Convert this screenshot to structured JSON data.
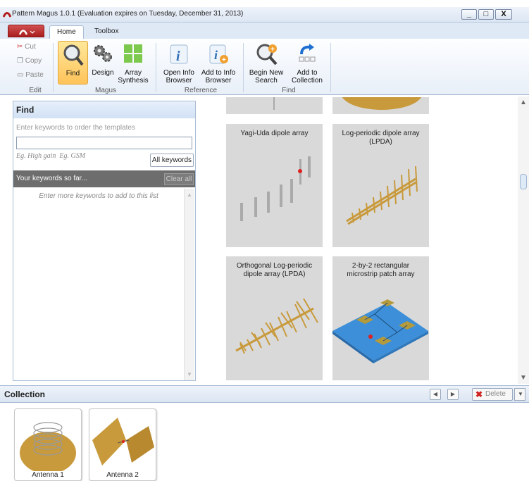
{
  "window": {
    "title": "Pattern Magus 1.0.1 (Evaluation expires on Tuesday, December 31, 2013)",
    "minimize_label": "_",
    "maximize_label": "□",
    "close_label": "X"
  },
  "tabs": {
    "home": "Home",
    "toolbox": "Toolbox"
  },
  "ribbon": {
    "edit": {
      "cut": "Cut",
      "copy": "Copy",
      "paste": "Paste",
      "group": "Edit"
    },
    "magus": {
      "find": "Find",
      "design": "Design",
      "array_synthesis": "Array\nSynthesis",
      "group": "Magus"
    },
    "reference": {
      "open_info": "Open Info\nBrowser",
      "add_info": "Add to Info\nBrowser",
      "group": "Reference"
    },
    "find": {
      "begin_search": "Begin New\nSearch",
      "add_collection": "Add to\nCollection",
      "group": "Find"
    }
  },
  "find_panel": {
    "title": "Find",
    "hint": "Enter keywords to order the templates",
    "examples": "Eg. High gain  Eg. GSM",
    "all_keywords": "All keywords",
    "your_keywords": "Your keywords so far...",
    "clear_all": "Clear all",
    "empty_hint": "Enter more keywords to add to this list",
    "input_value": ""
  },
  "gallery": [
    {
      "title": "Yagi-Uda dipole array"
    },
    {
      "title": "Log-periodic dipole array\n(LPDA)"
    },
    {
      "title": "Orthogonal Log-periodic\ndipole array (LPDA)"
    },
    {
      "title": "2-by-2 rectangular\nmicrostrip patch array"
    }
  ],
  "collection": {
    "title": "Collection",
    "delete": "Delete",
    "items": [
      {
        "label": "Antenna 1"
      },
      {
        "label": "Antenna 2"
      }
    ]
  },
  "colors": {
    "accent": "#ffc35a",
    "panel_header": "#d6e4f5",
    "card": "#d9d9d9",
    "gold": "#c89a3c",
    "patch_blue": "#3c8fd8"
  }
}
